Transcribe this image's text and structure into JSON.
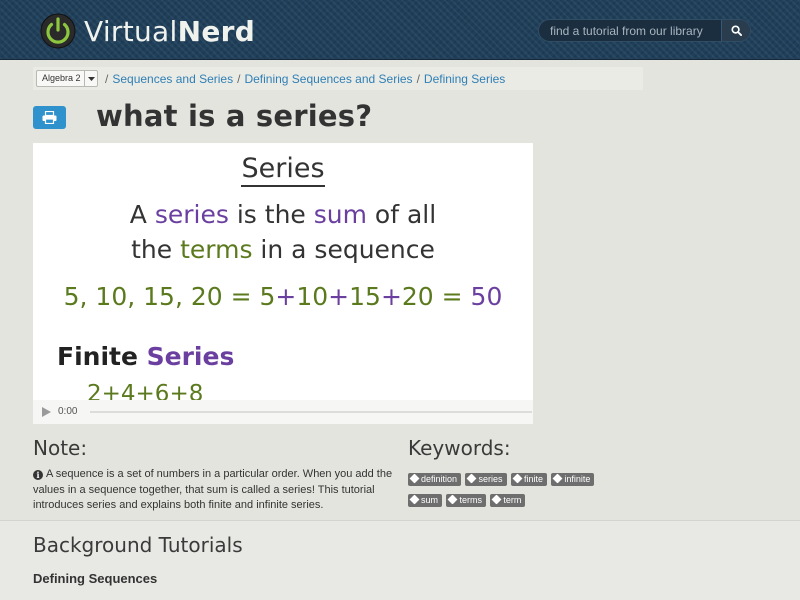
{
  "header": {
    "logo_text_light": "Virtual",
    "logo_text_bold": "Nerd",
    "search_placeholder": "find a tutorial from our library",
    "search_icon": "search-icon"
  },
  "breadcrumb": {
    "course": "Algebra 2",
    "items": [
      "Sequences and Series",
      "Defining Sequences and Series",
      "Defining Series"
    ]
  },
  "page": {
    "title": "what is a series?",
    "print_icon": "printer-icon"
  },
  "video": {
    "slide_title": "Series",
    "line1": [
      "A ",
      "series",
      " is the ",
      "sum",
      " of all"
    ],
    "line2": [
      "the ",
      "terms",
      " in a sequence"
    ],
    "example": [
      "5, 10, 15, 20 = 5",
      "+",
      "10",
      "+",
      "15",
      "+",
      "20 = ",
      "50"
    ],
    "finite_label": [
      "Finite ",
      "Series"
    ],
    "finite_example": "2+4+6+8",
    "time": "0:00",
    "progress": 0
  },
  "note": {
    "heading": "Note:",
    "text": "A sequence is a set of numbers in a particular order. When you add the values in a sequence together, that sum is called a series! This tutorial introduces series and explains both finite and infinite series."
  },
  "keywords": {
    "heading": "Keywords:",
    "tags": [
      "definition",
      "series",
      "finite",
      "infinite",
      "sum",
      "terms",
      "term"
    ]
  },
  "background": {
    "heading": "Background Tutorials",
    "items": [
      "Defining Sequences"
    ]
  },
  "colors": {
    "header_bg": "#1f3f5a",
    "logo_green": "#8dc63f",
    "link_blue": "#2f7fb4",
    "print_blue": "#2f92cc",
    "slide_purple": "#6a3fa0",
    "slide_green": "#5b7a1e",
    "tag_gray": "#6e6e6e"
  }
}
